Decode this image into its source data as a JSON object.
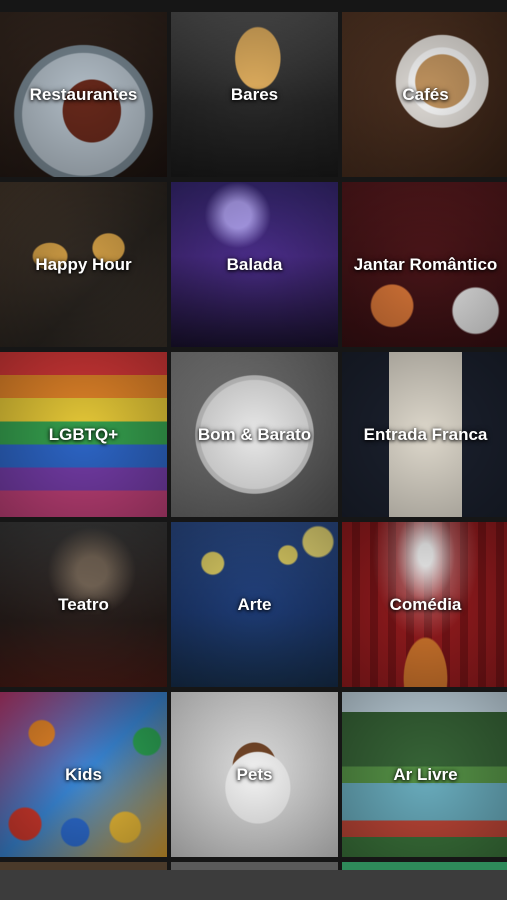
{
  "categories": [
    {
      "label": "Restaurantes"
    },
    {
      "label": "Bares"
    },
    {
      "label": "Cafés"
    },
    {
      "label": "Happy Hour"
    },
    {
      "label": "Balada"
    },
    {
      "label": "Jantar Romântico"
    },
    {
      "label": "LGBTQ+"
    },
    {
      "label": "Bom & Barato"
    },
    {
      "label": "Entrada Franca"
    },
    {
      "label": "Teatro"
    },
    {
      "label": "Arte"
    },
    {
      "label": "Comédia"
    },
    {
      "label": "Kids"
    },
    {
      "label": "Pets"
    },
    {
      "label": "Ar Livre"
    }
  ]
}
